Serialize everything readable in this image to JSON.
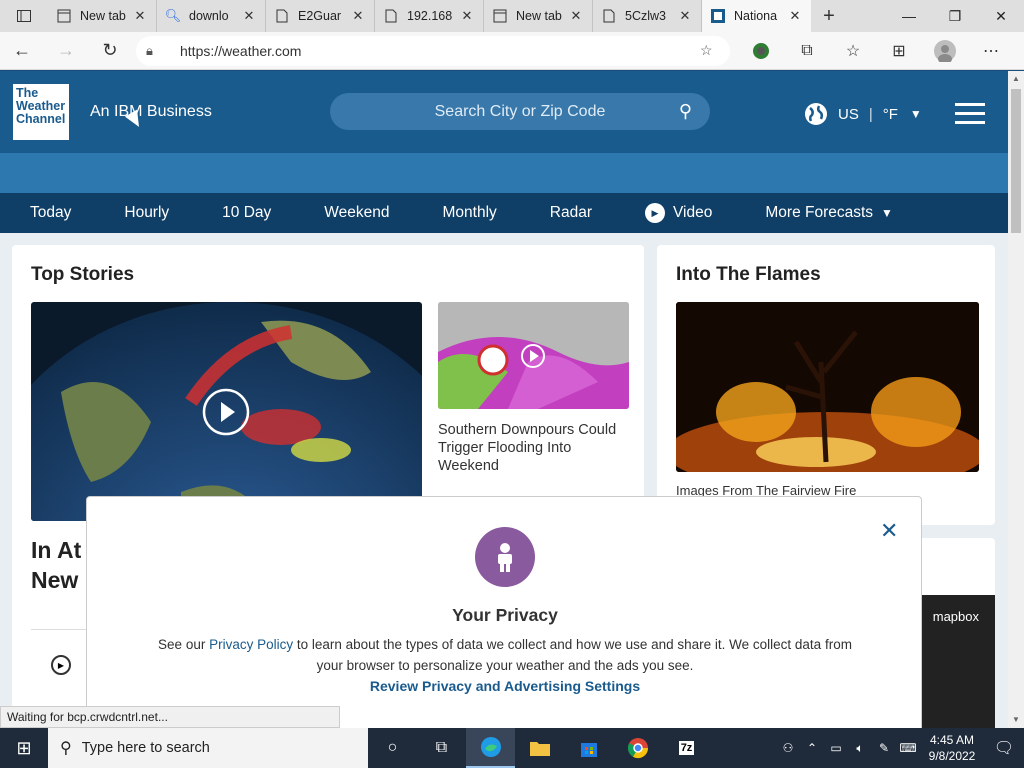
{
  "browser": {
    "tabs": [
      {
        "label": "New tab",
        "icon": "newtab-icon"
      },
      {
        "label": "downlo",
        "icon": "search-icon"
      },
      {
        "label": "E2Guar",
        "icon": "document-icon"
      },
      {
        "label": "192.168",
        "icon": "document-icon"
      },
      {
        "label": "New tab",
        "icon": "newtab-icon"
      },
      {
        "label": "5Czlw3",
        "icon": "document-icon"
      },
      {
        "label": "Nationa",
        "icon": "weather-channel-icon",
        "active": true
      }
    ],
    "new_tab": "+",
    "address": "https://weather.com",
    "status": "Waiting for bcp.crwdcntrl.net..."
  },
  "site": {
    "logo_lines": [
      "The",
      "Weather",
      "Channel"
    ],
    "tagline": "An IBM Business",
    "search_placeholder": "Search City or Zip Code",
    "locale": "US",
    "unit": "°F",
    "nav": [
      "Today",
      "Hourly",
      "10 Day",
      "Weekend",
      "Monthly",
      "Radar",
      "Video",
      "More Forecasts"
    ]
  },
  "top_stories": {
    "title": "Top Stories",
    "side_story": "Southern Downpours Could Trigger Flooding Into Weekend",
    "headline_partial_1": "In At",
    "headline_partial_2": "New"
  },
  "flames": {
    "title": "Into The Flames",
    "caption": "Images From The Fairview Fire",
    "mapbox": "mapbox"
  },
  "privacy": {
    "title": "Your Privacy",
    "text_before": "See our ",
    "link": "Privacy Policy",
    "text_after": " to learn about the types of data we collect and how we use and share it. We collect data from your browser to personalize your weather and the ads you see.",
    "review": "Review Privacy and Advertising Settings",
    "close": "✕"
  },
  "taskbar": {
    "search": "Type here to search",
    "time": "4:45 AM",
    "date": "9/8/2022"
  }
}
